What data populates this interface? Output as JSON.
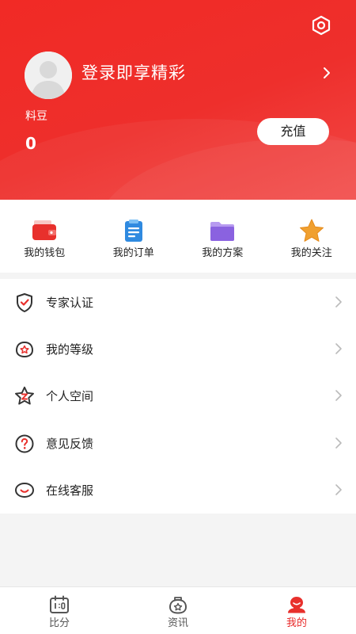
{
  "header": {
    "login_text": "登录即享精彩",
    "coin_label": "料豆",
    "coin_value": "0",
    "recharge_label": "充值"
  },
  "quick_actions": [
    {
      "label": "我的钱包",
      "icon": "wallet-icon"
    },
    {
      "label": "我的订单",
      "icon": "order-clipboard-icon"
    },
    {
      "label": "我的方案",
      "icon": "folder-icon"
    },
    {
      "label": "我的关注",
      "icon": "star-icon"
    }
  ],
  "menu": [
    {
      "label": "专家认证",
      "icon": "shield-check-icon"
    },
    {
      "label": "我的等级",
      "icon": "level-star-icon"
    },
    {
      "label": "个人空间",
      "icon": "personal-space-star-icon"
    },
    {
      "label": "意见反馈",
      "icon": "question-icon"
    },
    {
      "label": "在线客服",
      "icon": "chat-bubble-icon"
    }
  ],
  "bottom_nav": [
    {
      "label": "比分",
      "icon": "scoreboard-icon",
      "active": false
    },
    {
      "label": "资讯",
      "icon": "news-icon",
      "active": false
    },
    {
      "label": "我的",
      "icon": "profile-icon",
      "active": true
    }
  ],
  "colors": {
    "brand_red": "#ee2f2c",
    "active_tab": "#e82828",
    "wallet": "#e8302c",
    "order": "#2f8ae0",
    "folder": "#8a62e0",
    "star": "#f0a030"
  }
}
